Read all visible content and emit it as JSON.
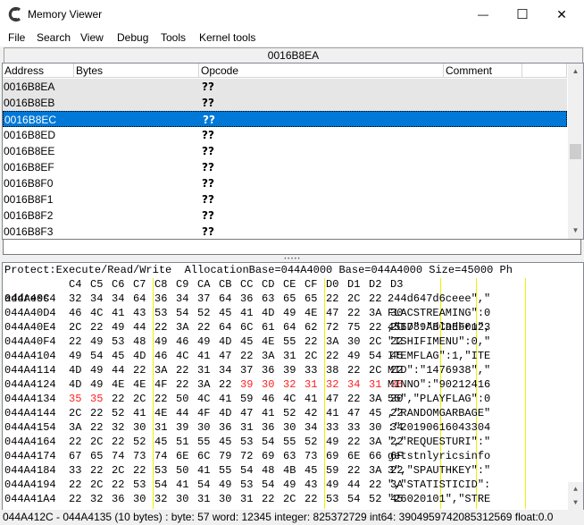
{
  "window": {
    "title": "Memory Viewer",
    "min_glyph": "—",
    "max_glyph": "☐",
    "close_glyph": "✕"
  },
  "menu": [
    "File",
    "Search",
    "View",
    "Debug",
    "Tools",
    "Kernel tools"
  ],
  "address_bar": "0016B8EA",
  "disasm": {
    "columns": [
      "Address",
      "Bytes",
      "Opcode",
      "Comment"
    ],
    "rows": [
      {
        "address": "0016B8EA",
        "opcode": "??"
      },
      {
        "address": "0016B8EB",
        "opcode": "??"
      },
      {
        "address": "0016B8EC",
        "opcode": "??"
      },
      {
        "address": "0016B8ED",
        "opcode": "??"
      },
      {
        "address": "0016B8EE",
        "opcode": "??"
      },
      {
        "address": "0016B8EF",
        "opcode": "??"
      },
      {
        "address": "0016B8F0",
        "opcode": "??"
      },
      {
        "address": "0016B8F1",
        "opcode": "??"
      },
      {
        "address": "0016B8F2",
        "opcode": "??"
      },
      {
        "address": "0016B8F3",
        "opcode": "??"
      }
    ],
    "selected_row": 2
  },
  "hex": {
    "protect_line": "Protect:Execute/Read/Write  AllocationBase=044A4000 Base=044A4000 Size=45000 Ph",
    "header_label": "address",
    "header_cols": [
      "C4",
      "C5",
      "C6",
      "C7",
      "C8",
      "C9",
      "CA",
      "CB",
      "CC",
      "CD",
      "CE",
      "CF",
      "D0",
      "D1",
      "D2",
      "D3"
    ],
    "header_ascii": "456789ABCDEF0123",
    "rows": [
      {
        "addr": "044A40C4",
        "bytes": [
          "32",
          "34",
          "34",
          "64",
          "36",
          "34",
          "37",
          "64",
          "36",
          "63",
          "65",
          "65",
          "22",
          "2C",
          "22"
        ],
        "ascii": "244d647d6ceee\",\""
      },
      {
        "addr": "044A40D4",
        "bytes": [
          "46",
          "4C",
          "41",
          "43",
          "53",
          "54",
          "52",
          "45",
          "41",
          "4D",
          "49",
          "4E",
          "47",
          "22",
          "3A",
          "30"
        ],
        "ascii": "FLACSTREAMING\":0"
      },
      {
        "addr": "044A40E4",
        "bytes": [
          "2C",
          "22",
          "49",
          "44",
          "22",
          "3A",
          "22",
          "64",
          "6C",
          "61",
          "64",
          "62",
          "72",
          "75",
          "22",
          "2C"
        ],
        "ascii": ",\"ID\":\"dladbru\","
      },
      {
        "addr": "044A40F4",
        "bytes": [
          "22",
          "49",
          "53",
          "48",
          "49",
          "46",
          "49",
          "4D",
          "45",
          "4E",
          "55",
          "22",
          "3A",
          "30",
          "2C",
          "22"
        ],
        "ascii": "\"ISHIFIMENU\":0,\""
      },
      {
        "addr": "044A4104",
        "bytes": [
          "49",
          "54",
          "45",
          "4D",
          "46",
          "4C",
          "41",
          "47",
          "22",
          "3A",
          "31",
          "2C",
          "22",
          "49",
          "54",
          "45"
        ],
        "ascii": "ITEMFLAG\":1,\"ITE"
      },
      {
        "addr": "044A4114",
        "bytes": [
          "4D",
          "49",
          "44",
          "22",
          "3A",
          "22",
          "31",
          "34",
          "37",
          "36",
          "39",
          "33",
          "38",
          "22",
          "2C",
          "22"
        ],
        "ascii": "MID\":\"1476938\",\""
      },
      {
        "addr": "044A4124",
        "bytes": [
          "4D",
          "49",
          "4E",
          "4E",
          "4F",
          "22",
          "3A",
          "22",
          "39",
          "30",
          "32",
          "31",
          "32",
          "34",
          "31",
          "36"
        ],
        "ascii": "MINNO\":\"90212416",
        "red_from": 8
      },
      {
        "addr": "044A4134",
        "bytes": [
          "35",
          "35",
          "22",
          "2C",
          "22",
          "50",
          "4C",
          "41",
          "59",
          "46",
          "4C",
          "41",
          "47",
          "22",
          "3A",
          "30"
        ],
        "ascii": "55\",\"PLAYFLAG\":0",
        "red_to": 2
      },
      {
        "addr": "044A4144",
        "bytes": [
          "2C",
          "22",
          "52",
          "41",
          "4E",
          "44",
          "4F",
          "4D",
          "47",
          "41",
          "52",
          "42",
          "41",
          "47",
          "45",
          "22"
        ],
        "ascii": ",\"RANDOMGARBAGE\""
      },
      {
        "addr": "044A4154",
        "bytes": [
          "3A",
          "22",
          "32",
          "30",
          "31",
          "39",
          "30",
          "36",
          "31",
          "36",
          "30",
          "34",
          "33",
          "33",
          "30",
          "34"
        ],
        "ascii": ":\"20190616043304"
      },
      {
        "addr": "044A4164",
        "bytes": [
          "22",
          "2C",
          "22",
          "52",
          "45",
          "51",
          "55",
          "45",
          "53",
          "54",
          "55",
          "52",
          "49",
          "22",
          "3A",
          "22"
        ],
        "ascii": "\",\"REQUESTURI\":\""
      },
      {
        "addr": "044A4174",
        "bytes": [
          "67",
          "65",
          "74",
          "73",
          "74",
          "6E",
          "6C",
          "79",
          "72",
          "69",
          "63",
          "73",
          "69",
          "6E",
          "66",
          "6F"
        ],
        "ascii": "getstnlyricsinfo"
      },
      {
        "addr": "044A4184",
        "bytes": [
          "33",
          "22",
          "2C",
          "22",
          "53",
          "50",
          "41",
          "55",
          "54",
          "48",
          "4B",
          "45",
          "59",
          "22",
          "3A",
          "22"
        ],
        "ascii": "3\",\"SPAUTHKEY\":\""
      },
      {
        "addr": "044A4194",
        "bytes": [
          "22",
          "2C",
          "22",
          "53",
          "54",
          "41",
          "54",
          "49",
          "53",
          "54",
          "49",
          "43",
          "49",
          "44",
          "22",
          "3A"
        ],
        "ascii": "\",\"STATISTICID\":"
      },
      {
        "addr": "044A41A4",
        "bytes": [
          "22",
          "32",
          "36",
          "30",
          "32",
          "30",
          "31",
          "30",
          "31",
          "22",
          "2C",
          "22",
          "53",
          "54",
          "52",
          "45"
        ],
        "ascii": "\"26020101\",\"STRE"
      }
    ]
  },
  "status": "044A412C - 044A4135 (10 bytes) : byte: 57 word: 12345 integer: 825372729 int64: 3904959742085312569 float:0.0"
}
